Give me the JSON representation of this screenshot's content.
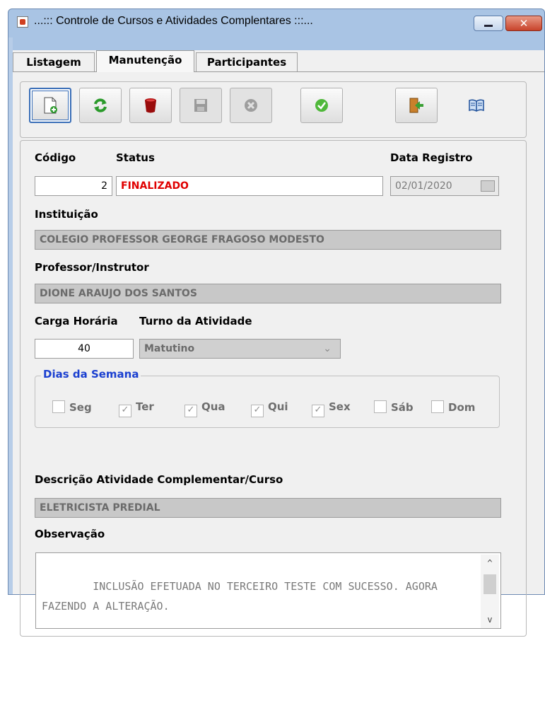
{
  "window": {
    "title": "...::: Controle de Cursos e Atividades Complentares :::...",
    "close_glyph": "✕"
  },
  "tabs": [
    {
      "label": "Listagem"
    },
    {
      "label": "Manutenção"
    },
    {
      "label": "Participantes"
    }
  ],
  "toolbar": {
    "buttons": [
      {
        "name": "new-icon",
        "enabled": true
      },
      {
        "name": "refresh-icon",
        "enabled": true
      },
      {
        "name": "delete-icon",
        "enabled": true
      },
      {
        "name": "save-icon",
        "enabled": false
      },
      {
        "name": "cancel-icon",
        "enabled": false
      },
      {
        "name": "confirm-icon",
        "enabled": true
      },
      {
        "name": "exit-icon",
        "enabled": true
      },
      {
        "name": "help-book-icon",
        "enabled": true
      }
    ]
  },
  "form": {
    "codigo_label": "Código",
    "codigo_value": "2",
    "status_label": "Status",
    "status_value": "FINALIZADO",
    "data_registro_label": "Data Registro",
    "data_registro_value": "02/01/2020",
    "instituicao_label": "Instituição",
    "instituicao_value": "COLEGIO PROFESSOR GEORGE FRAGOSO MODESTO",
    "professor_label": "Professor/Instrutor",
    "professor_value": "DIONE ARAUJO DOS SANTOS",
    "carga_horaria_label": "Carga Horária",
    "carga_horaria_value": "40",
    "turno_label": "Turno da Atividade",
    "turno_value": "Matutino",
    "dias_label": "Dias da Semana",
    "dias": [
      {
        "label": "Seg",
        "checked": false
      },
      {
        "label": "Ter",
        "checked": true
      },
      {
        "label": "Qua",
        "checked": true
      },
      {
        "label": "Qui",
        "checked": true
      },
      {
        "label": "Sex",
        "checked": true
      },
      {
        "label": "Sáb",
        "checked": false
      },
      {
        "label": "Dom",
        "checked": false
      }
    ],
    "descricao_label": "Descrição Atividade Complementar/Curso",
    "descricao_value": "ELETRICISTA PREDIAL",
    "observacao_label": "Observação",
    "observacao_value": "INCLUSÃO EFETUADA NO TERCEIRO TESTE COM SUCESSO. AGORA FAZENDO A ALTERAÇÃO."
  },
  "colors": {
    "status_text": "#e00000",
    "group_legend": "#1a3fd0"
  }
}
